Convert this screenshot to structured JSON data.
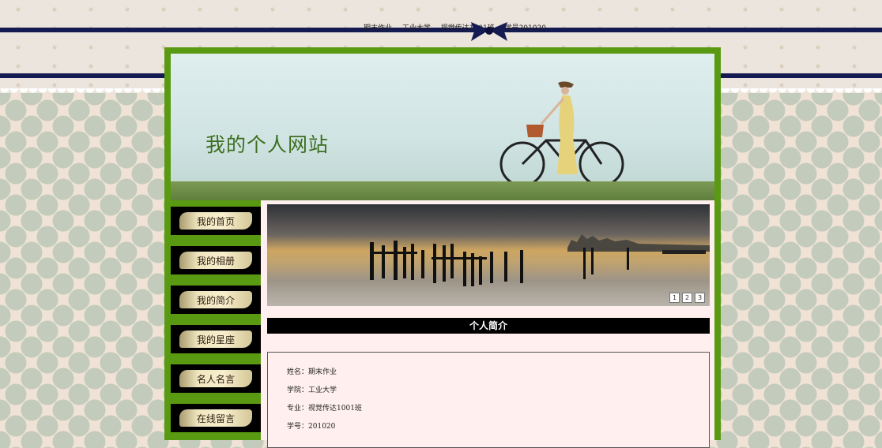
{
  "topnav": [
    "期末作业",
    "工业大学",
    "视觉传达1001班",
    "学号201020"
  ],
  "site_title": "我的个人网站",
  "nav": [
    "我的首页",
    "我的相册",
    "我的简介",
    "我的星座",
    "名人名言",
    "在线留言"
  ],
  "slider": {
    "pages": [
      "1",
      "2",
      "3"
    ]
  },
  "section": {
    "title": "个人简介"
  },
  "info": [
    {
      "label": "姓名：",
      "value": "期末作业"
    },
    {
      "label": "学院：",
      "value": "工业大学"
    },
    {
      "label": "专业：",
      "value": "视觉传达1001班"
    },
    {
      "label": "学号：",
      "value": "201020"
    }
  ],
  "colors": {
    "frame_green": "#5a9a12",
    "stripe_navy": "#141a52",
    "nav_black": "#000000",
    "content_pink": "#fff0ef"
  },
  "icons": [
    "bow-icon"
  ]
}
